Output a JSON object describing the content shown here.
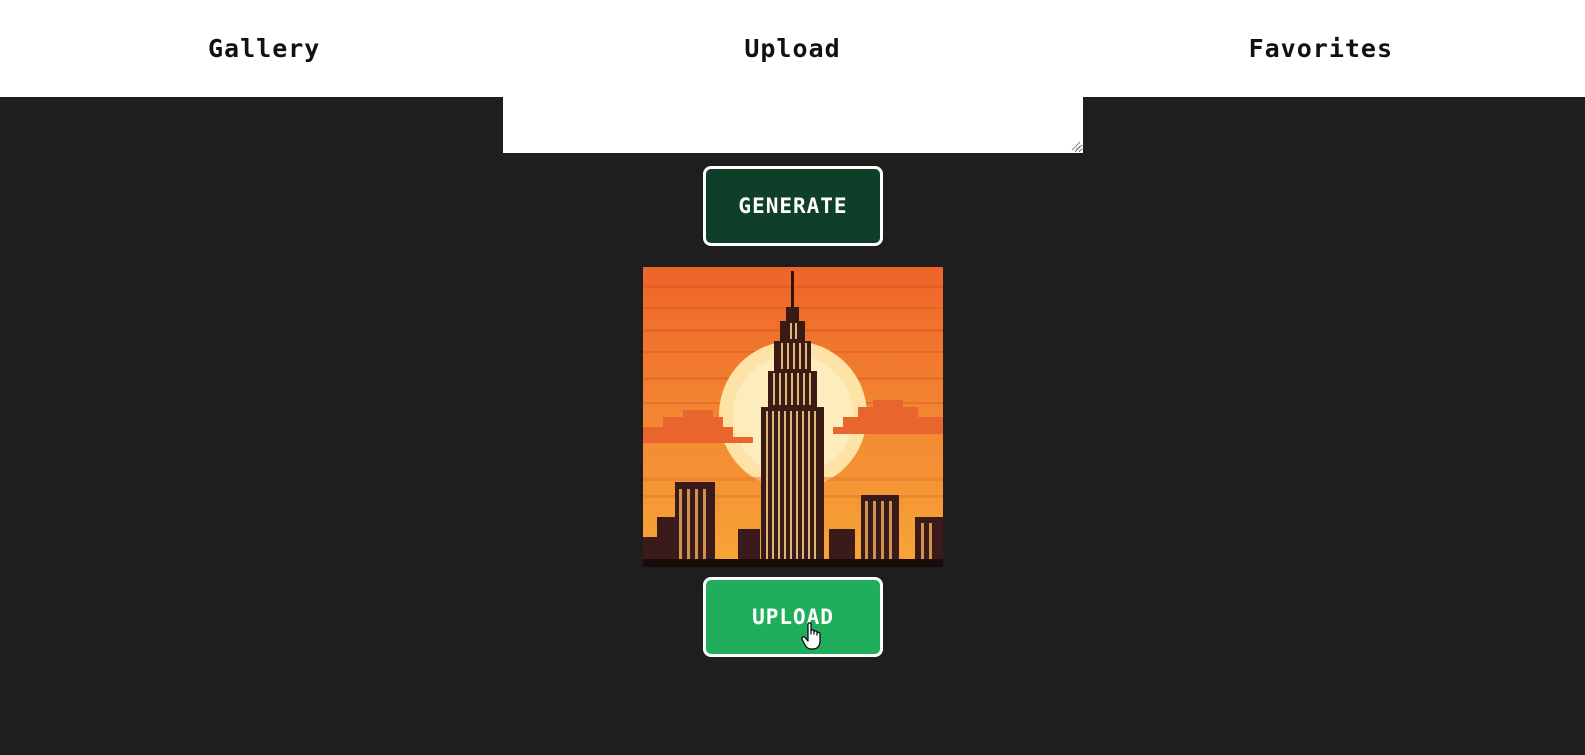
{
  "nav": {
    "items": [
      {
        "label": "Gallery"
      },
      {
        "label": "Upload"
      },
      {
        "label": "Favorites"
      }
    ]
  },
  "prompt": {
    "value": "",
    "placeholder": ""
  },
  "actions": {
    "generate_label": "GENERATE",
    "upload_label": "UPLOAD"
  },
  "preview": {
    "icon": "pixel-art-skyscraper-sunset-image"
  },
  "colors": {
    "background": "#1e1e1e",
    "nav_background": "#ffffff",
    "generate_button": "#0f3f28",
    "upload_button": "#20ae5c",
    "button_border": "#ffffff",
    "sky_top": "#f06a2a",
    "sky_bottom": "#f7a637",
    "sun": "#fde8b0"
  }
}
